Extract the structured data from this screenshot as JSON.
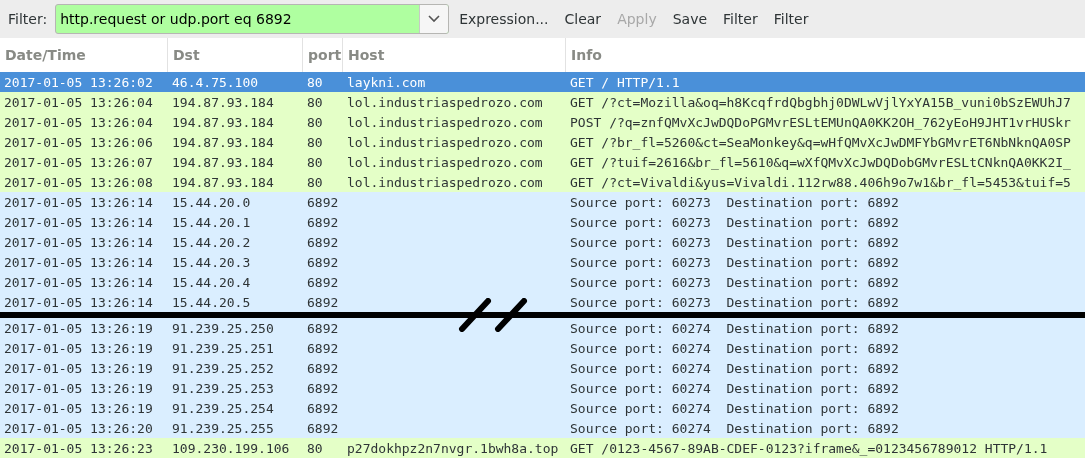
{
  "toolbar": {
    "label": "Filter:",
    "filter_value": "http.request or udp.port eq 6892",
    "filter_valid": true,
    "buttons": [
      {
        "label": "Expression...",
        "disabled": false
      },
      {
        "label": "Clear",
        "disabled": false
      },
      {
        "label": "Apply",
        "disabled": true
      },
      {
        "label": "Save",
        "disabled": false
      },
      {
        "label": "Filter",
        "disabled": false
      },
      {
        "label": "Filter",
        "disabled": false
      }
    ]
  },
  "columns": [
    "Date/Time",
    "Dst",
    "port",
    "Host",
    "Info"
  ],
  "row_groups": [
    [
      {
        "date": "2017-01-05 13:26:02",
        "dst": "46.4.75.100",
        "port": "80",
        "host": "laykni.com",
        "info": "GET / HTTP/1.1",
        "selected": true
      },
      {
        "date": "2017-01-05 13:26:04",
        "dst": "194.87.93.184",
        "port": "80",
        "host": "lol.industriaspedrozo.com",
        "info": "GET /?ct=Mozilla&oq=h8KcqfrdQbgbhj0DWLwVjlYxYA15B_vuni0bSzEWUhJ7",
        "color": "#e4ffc7",
        "selected": false
      },
      {
        "date": "2017-01-05 13:26:04",
        "dst": "194.87.93.184",
        "port": "80",
        "host": "lol.industriaspedrozo.com",
        "info": "POST /?q=znfQMvXcJwDQDoPGMvrESLtEMUnQA0KK2OH_762yEoH9JHT1vrHUSkr",
        "color": "#e4ffc7",
        "selected": false
      },
      {
        "date": "2017-01-05 13:26:06",
        "dst": "194.87.93.184",
        "port": "80",
        "host": "lol.industriaspedrozo.com",
        "info": "GET /?br_fl=5260&ct=SeaMonkey&q=wHfQMvXcJwDMFYbGMvrET6NbNknQA0SP",
        "color": "#e4ffc7",
        "selected": false
      },
      {
        "date": "2017-01-05 13:26:07",
        "dst": "194.87.93.184",
        "port": "80",
        "host": "lol.industriaspedrozo.com",
        "info": "GET /?tuif=2616&br_fl=5610&q=wXfQMvXcJwDQDobGMvrESLtCNknQA0KK2I_",
        "color": "#e4ffc7",
        "selected": false
      },
      {
        "date": "2017-01-05 13:26:08",
        "dst": "194.87.93.184",
        "port": "80",
        "host": "lol.industriaspedrozo.com",
        "info": "GET /?ct=Vivaldi&yus=Vivaldi.112rw88.406h9o7w1&br_fl=5453&tuif=5",
        "color": "#e4ffc7",
        "selected": false
      },
      {
        "date": "2017-01-05 13:26:14",
        "dst": "15.44.20.0",
        "port": "6892",
        "info": "Source port: 60273  Destination port: 6892",
        "color": "#daeeff",
        "selected": false
      },
      {
        "date": "2017-01-05 13:26:14",
        "dst": "15.44.20.1",
        "port": "6892",
        "info": "Source port: 60273  Destination port: 6892",
        "color": "#daeeff",
        "selected": false
      },
      {
        "date": "2017-01-05 13:26:14",
        "dst": "15.44.20.2",
        "port": "6892",
        "info": "Source port: 60273  Destination port: 6892",
        "color": "#daeeff",
        "selected": false
      },
      {
        "date": "2017-01-05 13:26:14",
        "dst": "15.44.20.3",
        "port": "6892",
        "info": "Source port: 60273  Destination port: 6892",
        "color": "#daeeff",
        "selected": false
      },
      {
        "date": "2017-01-05 13:26:14",
        "dst": "15.44.20.4",
        "port": "6892",
        "info": "Source port: 60273  Destination port: 6892",
        "color": "#daeeff",
        "selected": false
      },
      {
        "date": "2017-01-05 13:26:14",
        "dst": "15.44.20.5",
        "port": "6892",
        "info": "Source port: 60273  Destination port: 6892",
        "color": "#daeeff",
        "selected": false
      }
    ],
    [
      {
        "date": "2017-01-05 13:26:19",
        "dst": "91.239.25.250",
        "port": "6892",
        "info": "Source port: 60274  Destination port: 6892",
        "color": "#daeeff",
        "selected": false
      },
      {
        "date": "2017-01-05 13:26:19",
        "dst": "91.239.25.251",
        "port": "6892",
        "info": "Source port: 60274  Destination port: 6892",
        "color": "#daeeff",
        "selected": false
      },
      {
        "date": "2017-01-05 13:26:19",
        "dst": "91.239.25.252",
        "port": "6892",
        "info": "Source port: 60274  Destination port: 6892",
        "color": "#daeeff",
        "selected": false
      },
      {
        "date": "2017-01-05 13:26:19",
        "dst": "91.239.25.253",
        "port": "6892",
        "info": "Source port: 60274  Destination port: 6892",
        "color": "#daeeff",
        "selected": false
      },
      {
        "date": "2017-01-05 13:26:19",
        "dst": "91.239.25.254",
        "port": "6892",
        "info": "Source port: 60274  Destination port: 6892",
        "color": "#daeeff",
        "selected": false
      },
      {
        "date": "2017-01-05 13:26:20",
        "dst": "91.239.25.255",
        "port": "6892",
        "info": "Source port: 60274  Destination port: 6892",
        "color": "#daeeff",
        "selected": false
      },
      {
        "date": "2017-01-05 13:26:23",
        "dst": "109.230.199.106",
        "port": "80",
        "host": "p27dokhpz2n7nvgr.1bwh8a.top",
        "info": "GET /0123-4567-89AB-CDEF-0123?iframe&_=0123456789012 HTTP/1.1",
        "color": "#e4ffc7",
        "selected": false
      }
    ]
  ]
}
